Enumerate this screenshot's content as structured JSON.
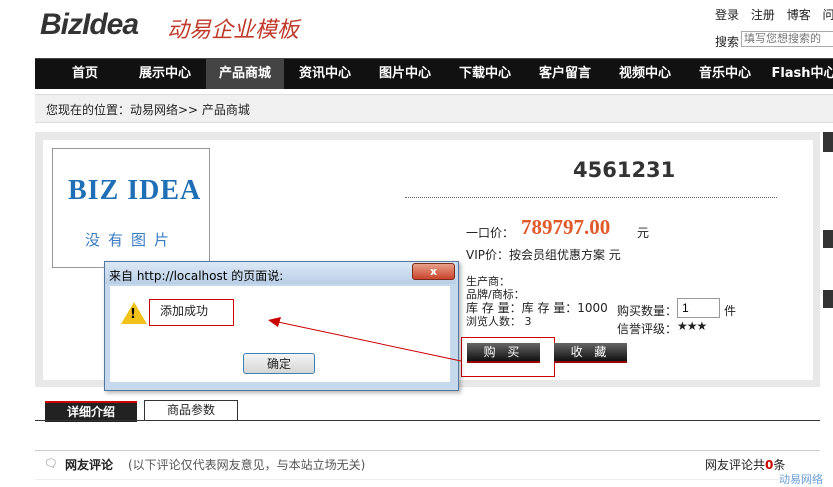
{
  "header": {
    "logo": "BizIdea",
    "logo_sub": "动易企业模板",
    "links": [
      "登录",
      "注册",
      "博客",
      "问答"
    ],
    "search_label": "搜索",
    "search_placeholder": "填写您想搜索的"
  },
  "nav": {
    "items": [
      "首页",
      "展示中心",
      "产品商城",
      "资讯中心",
      "图片中心",
      "下载中心",
      "客户留言",
      "视频中心",
      "音乐中心",
      "Flash中心"
    ],
    "active_index": 2
  },
  "breadcrumb": "您现在的位置：动易网络>> 产品商城",
  "product": {
    "image_logo": "BIZ IDEA",
    "image_placeholder": "没有图片",
    "title": "4561231",
    "price_label": "一口价：",
    "price": "789797.00",
    "price_unit": "元",
    "vip_text": "VIP价：按会员组优惠方案 元",
    "manufacturer": "生产商：",
    "brand": "品牌/商标：",
    "stock": "库 存 量：库 存 量：1000",
    "views": "浏览人数： 3",
    "qty_label": "购买数量：",
    "qty_value": "1",
    "qty_unit": "件",
    "rating_label": "信誉评级：",
    "rating_stars": "★★★",
    "buy_label": "购 买",
    "fav_label": "收 藏"
  },
  "tabs": {
    "detail": "详细介绍",
    "params": "商品参数"
  },
  "comments": {
    "title": "网友评论",
    "note": "(以下评论仅代表网友意见，与本站立场无关)",
    "count_prefix": "网友评论共",
    "count": "0",
    "count_suffix": "条"
  },
  "dialog": {
    "title": "来自 http://localhost 的页面说:",
    "message": "添加成功",
    "ok_label": "确定",
    "close_glyph": "x"
  },
  "watermark": "动易网络"
}
